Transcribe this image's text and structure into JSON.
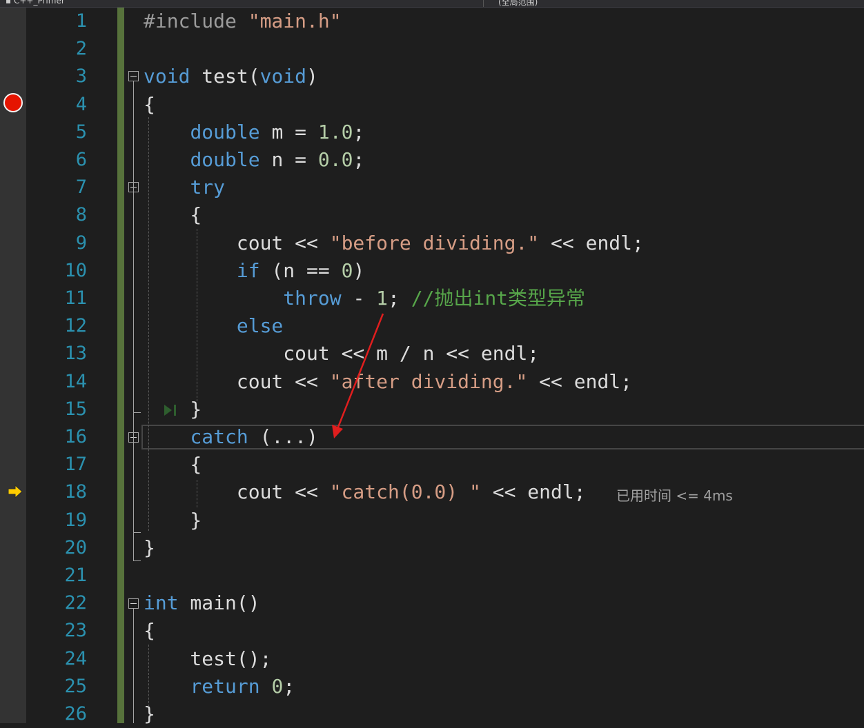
{
  "toolbar": {
    "project_combo": "C++_Primer",
    "scope_combo": "(全局范围)"
  },
  "editor": {
    "lines": [
      {
        "n": "1",
        "segs": [
          [
            "pp",
            "#include "
          ],
          [
            "str",
            "\"main.h\""
          ]
        ]
      },
      {
        "n": "2",
        "segs": []
      },
      {
        "n": "3",
        "segs": [
          [
            "kw",
            "void"
          ],
          [
            "",
            " test("
          ],
          [
            "kw",
            "void"
          ],
          [
            "",
            ")"
          ]
        ]
      },
      {
        "n": "4",
        "segs": [
          [
            "",
            "{"
          ]
        ]
      },
      {
        "n": "5",
        "segs": [
          [
            "",
            "    "
          ],
          [
            "kw",
            "double"
          ],
          [
            "",
            " m = "
          ],
          [
            "num",
            "1.0"
          ],
          [
            "",
            ";"
          ]
        ]
      },
      {
        "n": "6",
        "segs": [
          [
            "",
            "    "
          ],
          [
            "kw",
            "double"
          ],
          [
            "",
            " n = "
          ],
          [
            "num",
            "0.0"
          ],
          [
            "",
            ";"
          ]
        ]
      },
      {
        "n": "7",
        "segs": [
          [
            "",
            "    "
          ],
          [
            "kw",
            "try"
          ]
        ]
      },
      {
        "n": "8",
        "segs": [
          [
            "",
            "    {"
          ]
        ]
      },
      {
        "n": "9",
        "segs": [
          [
            "",
            "        cout << "
          ],
          [
            "str",
            "\"before dividing.\""
          ],
          [
            "",
            " << endl;"
          ]
        ]
      },
      {
        "n": "10",
        "segs": [
          [
            "",
            "        "
          ],
          [
            "kw",
            "if"
          ],
          [
            "",
            " (n == "
          ],
          [
            "num",
            "0"
          ],
          [
            "",
            ")"
          ]
        ]
      },
      {
        "n": "11",
        "segs": [
          [
            "",
            "            "
          ],
          [
            "kw",
            "throw"
          ],
          [
            "",
            " - "
          ],
          [
            "num",
            "1"
          ],
          [
            "",
            "; "
          ],
          [
            "cm",
            "//抛出int类型异常"
          ]
        ]
      },
      {
        "n": "12",
        "segs": [
          [
            "",
            "        "
          ],
          [
            "kw",
            "else"
          ]
        ]
      },
      {
        "n": "13",
        "segs": [
          [
            "",
            "            cout << m / n << endl;"
          ]
        ]
      },
      {
        "n": "14",
        "segs": [
          [
            "",
            "        cout << "
          ],
          [
            "str",
            "\"after dividing.\""
          ],
          [
            "",
            " << endl;"
          ]
        ]
      },
      {
        "n": "15",
        "segs": [
          [
            "",
            "    }"
          ]
        ]
      },
      {
        "n": "16",
        "segs": [
          [
            "",
            "    "
          ],
          [
            "kw",
            "catch"
          ],
          [
            "",
            " (...)"
          ]
        ]
      },
      {
        "n": "17",
        "segs": [
          [
            "",
            "    {"
          ]
        ]
      },
      {
        "n": "18",
        "segs": [
          [
            "",
            "        cout << "
          ],
          [
            "str",
            "\"catch(0.0) \""
          ],
          [
            "",
            " << endl;"
          ]
        ]
      },
      {
        "n": "19",
        "segs": [
          [
            "",
            "    }"
          ]
        ]
      },
      {
        "n": "20",
        "segs": [
          [
            "",
            "}"
          ]
        ]
      },
      {
        "n": "21",
        "segs": []
      },
      {
        "n": "22",
        "segs": [
          [
            "kw",
            "int"
          ],
          [
            "",
            " main()"
          ]
        ]
      },
      {
        "n": "23",
        "segs": [
          [
            "",
            "{"
          ]
        ]
      },
      {
        "n": "24",
        "segs": [
          [
            "",
            "    test();"
          ]
        ]
      },
      {
        "n": "25",
        "segs": [
          [
            "",
            "    "
          ],
          [
            "kw",
            "return"
          ],
          [
            "",
            " "
          ],
          [
            "num",
            "0"
          ],
          [
            "",
            ";"
          ]
        ]
      },
      {
        "n": "26",
        "segs": [
          [
            "",
            "}"
          ]
        ]
      }
    ],
    "perf_tip": "已用时间 <= 4ms",
    "breakpoint_line": "4",
    "current_line": "18",
    "icons": {
      "breakpoint": "breakpoint-icon",
      "exec": "execution-arrow-icon",
      "run_to_click": "run-to-click-icon",
      "fold": "collapse-icon"
    }
  },
  "colors": {
    "background": "#1e1e1e",
    "line_number": "#2b91af",
    "keyword": "#569cd6",
    "string": "#d69d85",
    "number": "#b5cea8",
    "comment": "#57a64a",
    "change_bar": "#57723b",
    "annotation_arrow": "#e01e1e"
  }
}
